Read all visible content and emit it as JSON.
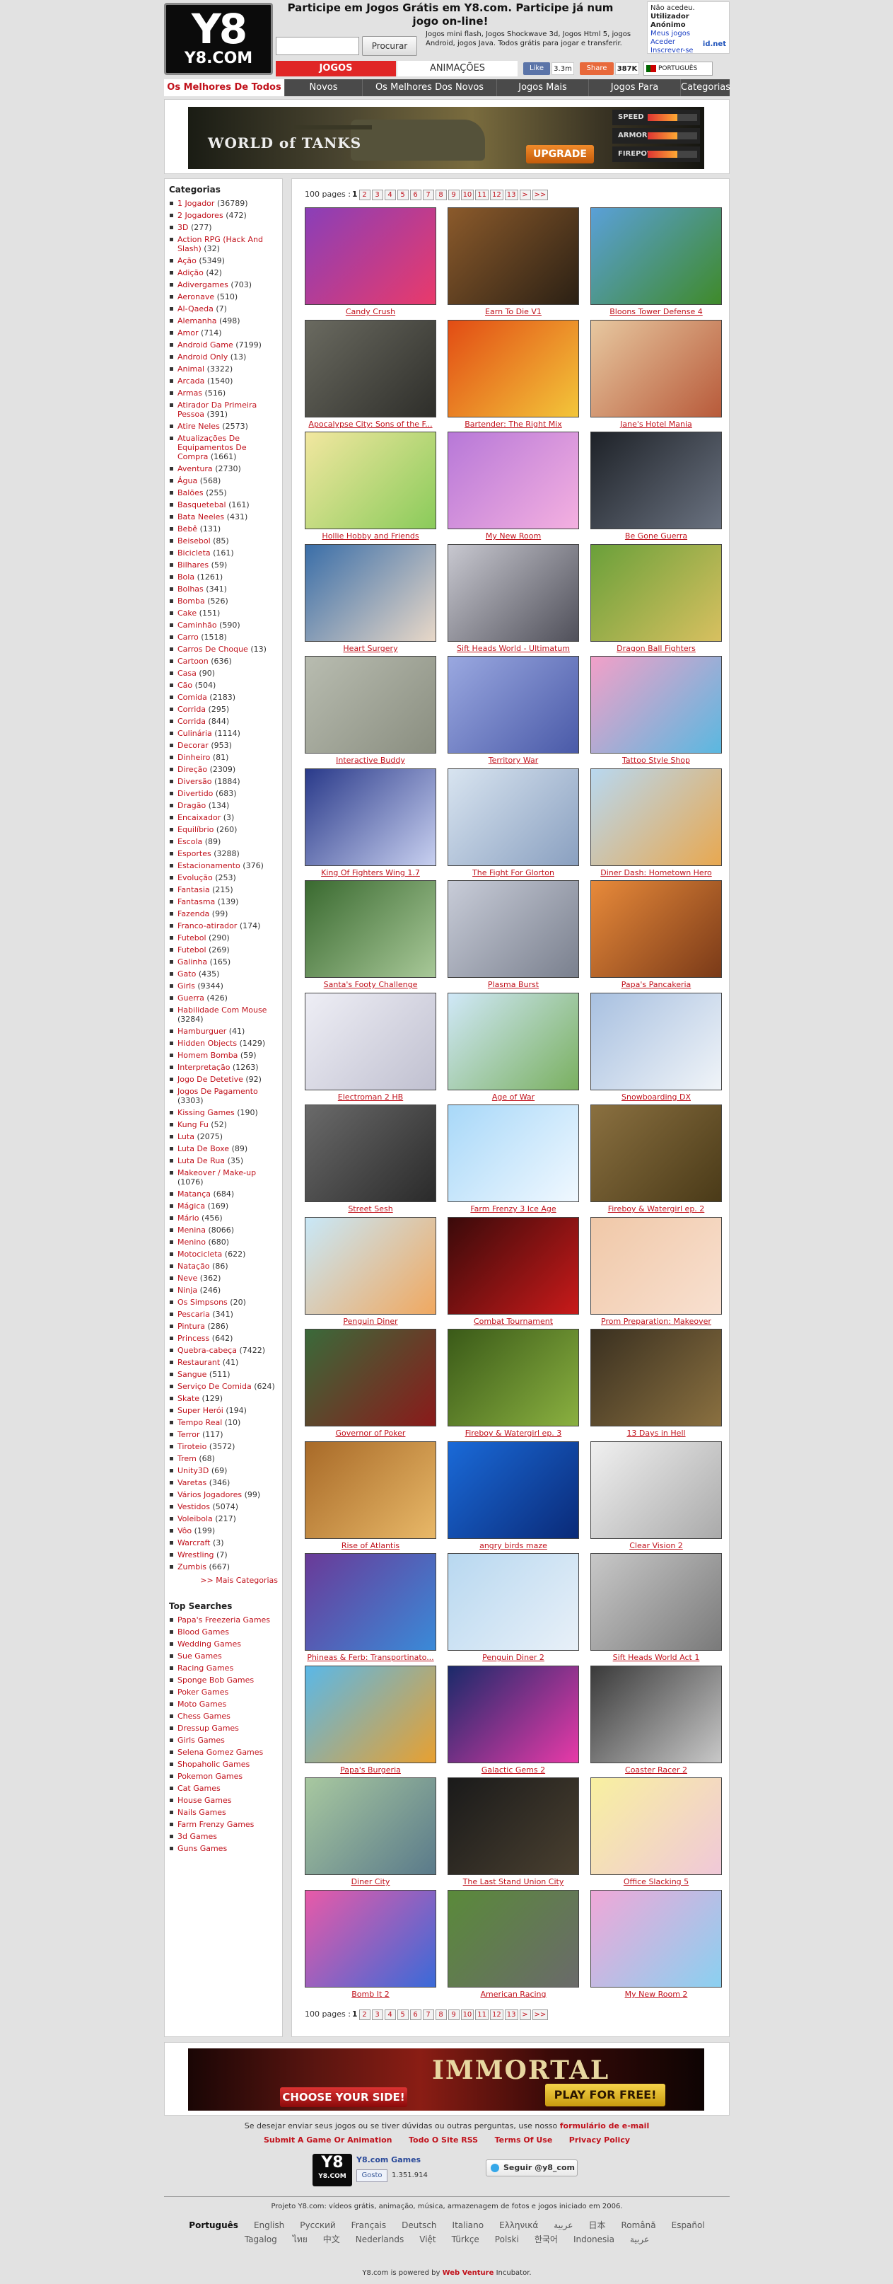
{
  "header": {
    "logo_top": "Y8",
    "logo_bottom": "Y8.COM",
    "tagline": "Participe em Jogos Grátis em Y8.com. Participe já num jogo on-line!",
    "search_placeholder": "",
    "search_button": "Procurar",
    "subline": "Jogos mini flash, Jogos Shockwave 3d, Jogos Html 5, jogos Android, jogos Java. Todos grátis para jogar e transferir.",
    "login_line1": "Não acedeu.",
    "login_line2": "Utilizador Anónimo",
    "login_links": [
      "Meus jogos",
      "Aceder",
      "Inscrever-se"
    ],
    "login_net": "id.net"
  },
  "tabs": {
    "jogos": "JOGOS",
    "animacoes": "ANIMAÇÕES"
  },
  "social": {
    "like": "Like",
    "like_count": "3.3m",
    "share": "Share",
    "share_count": "387K"
  },
  "language_selector": "PORTUGUÊS",
  "nav": [
    "Os Melhores De Todos Os",
    "Novos",
    "Os Melhores Dos Novos",
    "Jogos Mais",
    "Jogos Para",
    "Categorias"
  ],
  "ads": {
    "wot": {
      "title": "WORLD of TANKS",
      "button": "UPGRADE",
      "stats": [
        "SPEED",
        "ARMOR",
        "FIREPOWER"
      ]
    },
    "immortal": {
      "left": "CHOOSE YOUR SIDE!",
      "title": "IMMORTAL",
      "button": "PLAY FOR FREE!"
    }
  },
  "sidebar": {
    "categories_title": "Categorias",
    "categories": [
      [
        "1 Jogador",
        "(36789)"
      ],
      [
        "2 Jogadores",
        "(472)"
      ],
      [
        "3D",
        "(277)"
      ],
      [
        "Action RPG (Hack And Slash)",
        "(32)"
      ],
      [
        "Ação",
        "(5349)"
      ],
      [
        "Adição",
        "(42)"
      ],
      [
        "Adivergames",
        "(703)"
      ],
      [
        "Aeronave",
        "(510)"
      ],
      [
        "Al-Qaeda",
        "(7)"
      ],
      [
        "Alemanha",
        "(498)"
      ],
      [
        "Amor",
        "(714)"
      ],
      [
        "Android Game",
        "(7199)"
      ],
      [
        "Android Only",
        "(13)"
      ],
      [
        "Animal",
        "(3322)"
      ],
      [
        "Arcada",
        "(1540)"
      ],
      [
        "Armas",
        "(516)"
      ],
      [
        "Atirador Da Primeira Pessoa",
        "(391)"
      ],
      [
        "Atire Neles",
        "(2573)"
      ],
      [
        "Atualizações De Equipamentos De Compra",
        "(1661)"
      ],
      [
        "Aventura",
        "(2730)"
      ],
      [
        "Água",
        "(568)"
      ],
      [
        "Balões",
        "(255)"
      ],
      [
        "Basquetebal",
        "(161)"
      ],
      [
        "Bata Neeles",
        "(431)"
      ],
      [
        "Bebê",
        "(131)"
      ],
      [
        "Beisebol",
        "(85)"
      ],
      [
        "Bicicleta",
        "(161)"
      ],
      [
        "Bilhares",
        "(59)"
      ],
      [
        "Bola",
        "(1261)"
      ],
      [
        "Bolhas",
        "(341)"
      ],
      [
        "Bomba",
        "(526)"
      ],
      [
        "Cake",
        "(151)"
      ],
      [
        "Caminhão",
        "(590)"
      ],
      [
        "Carro",
        "(1518)"
      ],
      [
        "Carros De Choque",
        "(13)"
      ],
      [
        "Cartoon",
        "(636)"
      ],
      [
        "Casa",
        "(90)"
      ],
      [
        "Cão",
        "(504)"
      ],
      [
        "Comida",
        "(2183)"
      ],
      [
        "Corrida",
        "(295)"
      ],
      [
        "Corrida",
        "(844)"
      ],
      [
        "Culinária",
        "(1114)"
      ],
      [
        "Decorar",
        "(953)"
      ],
      [
        "Dinheiro",
        "(81)"
      ],
      [
        "Direção",
        "(2309)"
      ],
      [
        "Diversão",
        "(1884)"
      ],
      [
        "Divertido",
        "(683)"
      ],
      [
        "Dragão",
        "(134)"
      ],
      [
        "Encaixador",
        "(3)"
      ],
      [
        "Equilíbrio",
        "(260)"
      ],
      [
        "Escola",
        "(89)"
      ],
      [
        "Esportes",
        "(3288)"
      ],
      [
        "Estacionamento",
        "(376)"
      ],
      [
        "Evolução",
        "(253)"
      ],
      [
        "Fantasia",
        "(215)"
      ],
      [
        "Fantasma",
        "(139)"
      ],
      [
        "Fazenda",
        "(99)"
      ],
      [
        "Franco-atirador",
        "(174)"
      ],
      [
        "Futebol",
        "(290)"
      ],
      [
        "Futebol",
        "(269)"
      ],
      [
        "Galinha",
        "(165)"
      ],
      [
        "Gato",
        "(435)"
      ],
      [
        "Girls",
        "(9344)"
      ],
      [
        "Guerra",
        "(426)"
      ],
      [
        "Habilidade Com Mouse",
        "(3284)"
      ],
      [
        "Hamburguer",
        "(41)"
      ],
      [
        "Hidden Objects",
        "(1429)"
      ],
      [
        "Homem Bomba",
        "(59)"
      ],
      [
        "Interpretação",
        "(1263)"
      ],
      [
        "Jogo De Detetive",
        "(92)"
      ],
      [
        "Jogos De Pagamento",
        "(3303)"
      ],
      [
        "Kissing Games",
        "(190)"
      ],
      [
        "Kung Fu",
        "(52)"
      ],
      [
        "Luta",
        "(2075)"
      ],
      [
        "Luta De Boxe",
        "(89)"
      ],
      [
        "Luta De Rua",
        "(35)"
      ],
      [
        "Makeover / Make-up",
        "(1076)"
      ],
      [
        "Matança",
        "(684)"
      ],
      [
        "Mágica",
        "(169)"
      ],
      [
        "Mário",
        "(456)"
      ],
      [
        "Menina",
        "(8066)"
      ],
      [
        "Menino",
        "(680)"
      ],
      [
        "Motocicleta",
        "(622)"
      ],
      [
        "Natação",
        "(86)"
      ],
      [
        "Neve",
        "(362)"
      ],
      [
        "Ninja",
        "(246)"
      ],
      [
        "Os Simpsons",
        "(20)"
      ],
      [
        "Pescaria",
        "(341)"
      ],
      [
        "Pintura",
        "(286)"
      ],
      [
        "Princess",
        "(642)"
      ],
      [
        "Quebra-cabeça",
        "(7422)"
      ],
      [
        "Restaurant",
        "(41)"
      ],
      [
        "Sangue",
        "(511)"
      ],
      [
        "Serviço De Comida",
        "(624)"
      ],
      [
        "Skate",
        "(129)"
      ],
      [
        "Super Herói",
        "(194)"
      ],
      [
        "Tempo Real",
        "(10)"
      ],
      [
        "Terror",
        "(117)"
      ],
      [
        "Tiroteio",
        "(3572)"
      ],
      [
        "Trem",
        "(68)"
      ],
      [
        "Unity3D",
        "(69)"
      ],
      [
        "Varetas",
        "(346)"
      ],
      [
        "Vários Jogadores",
        "(99)"
      ],
      [
        "Vestidos",
        "(5074)"
      ],
      [
        "Voleibola",
        "(217)"
      ],
      [
        "Vôo",
        "(199)"
      ],
      [
        "Warcraft",
        "(3)"
      ],
      [
        "Wrestling",
        "(7)"
      ],
      [
        "Zumbis",
        "(667)"
      ]
    ],
    "more_categories": ">> Mais Categorias",
    "top_title": "Top Searches",
    "top_searches": [
      "Papa's Freezeria Games",
      "Blood Games",
      "Wedding Games",
      "Sue Games",
      "Racing Games",
      "Sponge Bob Games",
      "Poker Games",
      "Moto Games",
      "Chess Games",
      "Dressup Games",
      "Girls Games",
      "Selena Gomez Games",
      "Shopaholic Games",
      "Pokemon Games",
      "Cat Games",
      "House Games",
      "Nails Games",
      "Farm Frenzy Games",
      "3d Games",
      "Guns Games"
    ]
  },
  "pager": {
    "label": "100 pages :",
    "current": "1",
    "pages": [
      "2",
      "3",
      "4",
      "5",
      "6",
      "7",
      "8",
      "9",
      "10",
      "11",
      "12",
      "13",
      ">",
      ">>"
    ]
  },
  "games": [
    [
      "Candy Crush",
      "#8a3fb8",
      "#e93a6b"
    ],
    [
      "Earn To Die V1",
      "#8b5a2b",
      "#2b2014"
    ],
    [
      "Bloons Tower Defense 4",
      "#5aa0d8",
      "#3f8a2a"
    ],
    [
      "Apocalypse City: Sons of the F...",
      "#6a6a60",
      "#2e2e2a"
    ],
    [
      "Bartender: The Right Mix",
      "#e24c14",
      "#f3c63a"
    ],
    [
      "Jane's Hotel Mania",
      "#e7c8a0",
      "#b85a3a"
    ],
    [
      "Hollie Hobby and Friends",
      "#f2e7a0",
      "#8acb5a"
    ],
    [
      "My New Room",
      "#b778d8",
      "#f4b0e0"
    ],
    [
      "Be Gone Guerra",
      "#1e2228",
      "#6a7280"
    ],
    [
      "Heart Surgery",
      "#3a6ea8",
      "#e8d8c8"
    ],
    [
      "Sift Heads World - Ultimatum",
      "#c8c8d0",
      "#50505a"
    ],
    [
      "Dragon Ball Fighters",
      "#6aa03a",
      "#d8c060"
    ],
    [
      "Interactive Buddy",
      "#b8bcb0",
      "#8a8e80"
    ],
    [
      "Territory War",
      "#9aa8e0",
      "#4a5aa8"
    ],
    [
      "Tattoo Style Shop",
      "#f2a0c8",
      "#5ab8e0"
    ],
    [
      "King Of Fighters Wing 1.7",
      "#2a3a8a",
      "#c8d0f0"
    ],
    [
      "The Fight For Glorton",
      "#d8e4f0",
      "#8aa0c0"
    ],
    [
      "Diner Dash: Hometown Hero",
      "#b8d8f0",
      "#e8a850"
    ],
    [
      "Santa's Footy Challenge",
      "#3a6a30",
      "#a8c898"
    ],
    [
      "Plasma Burst",
      "#c8ccd8",
      "#7a808e"
    ],
    [
      "Papa's Pancakeria",
      "#e88a3a",
      "#7a3a18"
    ],
    [
      "Electroman 2 HB",
      "#eeeef5",
      "#c0c0d0"
    ],
    [
      "Age of War",
      "#d0e8f8",
      "#7ab060"
    ],
    [
      "Snowboarding DX",
      "#a8c0e0",
      "#f0f4f8"
    ],
    [
      "Street Sesh",
      "#6a6a6a",
      "#2a2a2a"
    ],
    [
      "Farm Frenzy 3 Ice Age",
      "#a8d8f8",
      "#f0f8ff"
    ],
    [
      "Fireboy & Watergirl ep. 2",
      "#8a7040",
      "#4a3a18"
    ],
    [
      "Penguin Diner",
      "#c8e8f8",
      "#f0a860"
    ],
    [
      "Combat Tournament",
      "#3a0a0a",
      "#c81a1a"
    ],
    [
      "Prom Preparation: Makeover",
      "#f0c8a8",
      "#f8e0d0"
    ],
    [
      "Governor of Poker",
      "#3a6a3a",
      "#8a1a1a"
    ],
    [
      "Fireboy & Watergirl ep. 3",
      "#3a5a18",
      "#8ab040"
    ],
    [
      "13 Days in Hell",
      "#3a3020",
      "#8a7040"
    ],
    [
      "Rise of Atlantis",
      "#a86a28",
      "#e8b868"
    ],
    [
      "angry birds maze",
      "#1a6ad8",
      "#0a2a78"
    ],
    [
      "Clear Vision 2",
      "#f0f0f0",
      "#aaaaaa"
    ],
    [
      "Phineas & Ferb: Transportinato...",
      "#6a3a98",
      "#3a8ad8"
    ],
    [
      "Penguin Diner 2",
      "#b8d8f0",
      "#e8f0f8"
    ],
    [
      "Sift Heads World Act 1",
      "#c8c8c8",
      "#7a7a7a"
    ],
    [
      "Papa's Burgeria",
      "#5ab8e8",
      "#e8a030"
    ],
    [
      "Galactic Gems 2",
      "#1a2a6a",
      "#e83aa8"
    ],
    [
      "Coaster Racer 2",
      "#3a3a3a",
      "#c8c8c8"
    ],
    [
      "Diner City",
      "#a8c8a0",
      "#5a7a8a"
    ],
    [
      "The Last Stand Union City",
      "#1a1a1a",
      "#4a4030"
    ],
    [
      "Office Slacking 5",
      "#f8f0a0",
      "#f0c8d8"
    ],
    [
      "Bomb It 2",
      "#e85aa8",
      "#3a6ad8"
    ],
    [
      "American Racing",
      "#5a8a3a",
      "#6a6a6a"
    ],
    [
      "My New Room 2",
      "#f0a8d8",
      "#8ad0f0"
    ]
  ],
  "footer": {
    "contact": "Se desejar enviar seus jogos ou se tiver dúvidas ou outras perguntas, use nosso",
    "contact_link": "formulário de e-mail",
    "links": [
      "Submit A Game Or Animation",
      "Todo O Site RSS",
      "Terms Of Use",
      "Privacy Policy"
    ],
    "y8_games": "Y8.com Games",
    "gosto": "Gosto",
    "gosto_count": "1.351.914",
    "follow": "Seguir @y8_com",
    "project": "Projeto Y8.com: vídeos grátis, animação, música, armazenagem de fotos e jogos iniciado em 2006.",
    "languages_row1": [
      "Português",
      "English",
      "Русский",
      "Français",
      "Deutsch",
      "Italiano",
      "Ελληνικά",
      "عربية",
      "日本",
      "Română",
      "Español"
    ],
    "languages_row2": [
      "Tagalog",
      "ไทย",
      "中文",
      "Nederlands",
      "Việt",
      "Türkçe",
      "Polski",
      "한국어",
      "Indonesia",
      "عربية"
    ],
    "powered": "Y8.com is powered by",
    "powered_link": "Web Venture",
    "powered_tail": "Incubator."
  }
}
